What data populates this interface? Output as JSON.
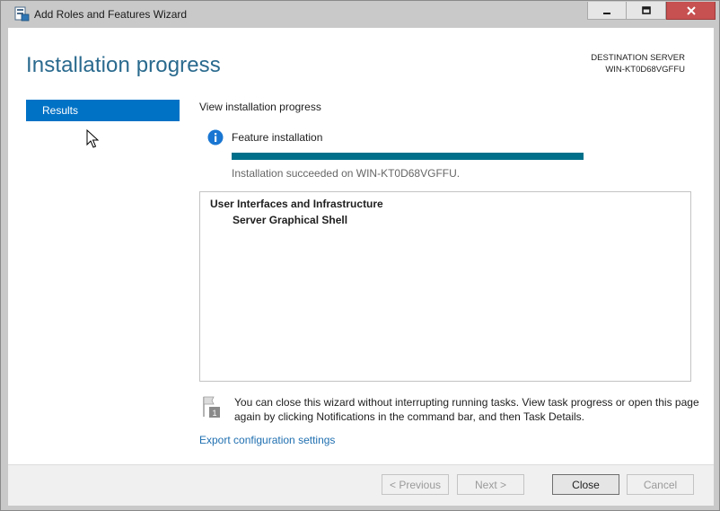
{
  "window": {
    "title": "Add Roles and Features Wizard",
    "close_color": "#c75050"
  },
  "header": {
    "page_title": "Installation progress",
    "destination_label": "DESTINATION SERVER",
    "destination_server": "WIN-KT0D68VGFFU"
  },
  "nav": {
    "items": [
      {
        "label": "Results",
        "selected": true
      }
    ]
  },
  "main": {
    "view_label": "View installation progress",
    "feature_label": "Feature installation",
    "progress_percent": 100,
    "status_text": "Installation succeeded on WIN-KT0D68VGFFU.",
    "results": {
      "group": "User Interfaces and Infrastructure",
      "child": "Server Graphical Shell"
    },
    "note": "You can close this wizard without interrupting running tasks. View task progress or open this page again by clicking Notifications in the command bar, and then Task Details.",
    "export_link": "Export configuration settings"
  },
  "footer": {
    "previous_label": "< Previous",
    "next_label": "Next >",
    "close_label": "Close",
    "cancel_label": "Cancel"
  },
  "icons": {
    "app": "server-manager-icon",
    "info": "info-icon",
    "flag": "notification-flag-icon",
    "cursor": "mouse-cursor-icon"
  },
  "colors": {
    "accent": "#0072c6",
    "title": "#2a6a8e",
    "progress": "#00708a",
    "link": "#1f6fb0"
  }
}
